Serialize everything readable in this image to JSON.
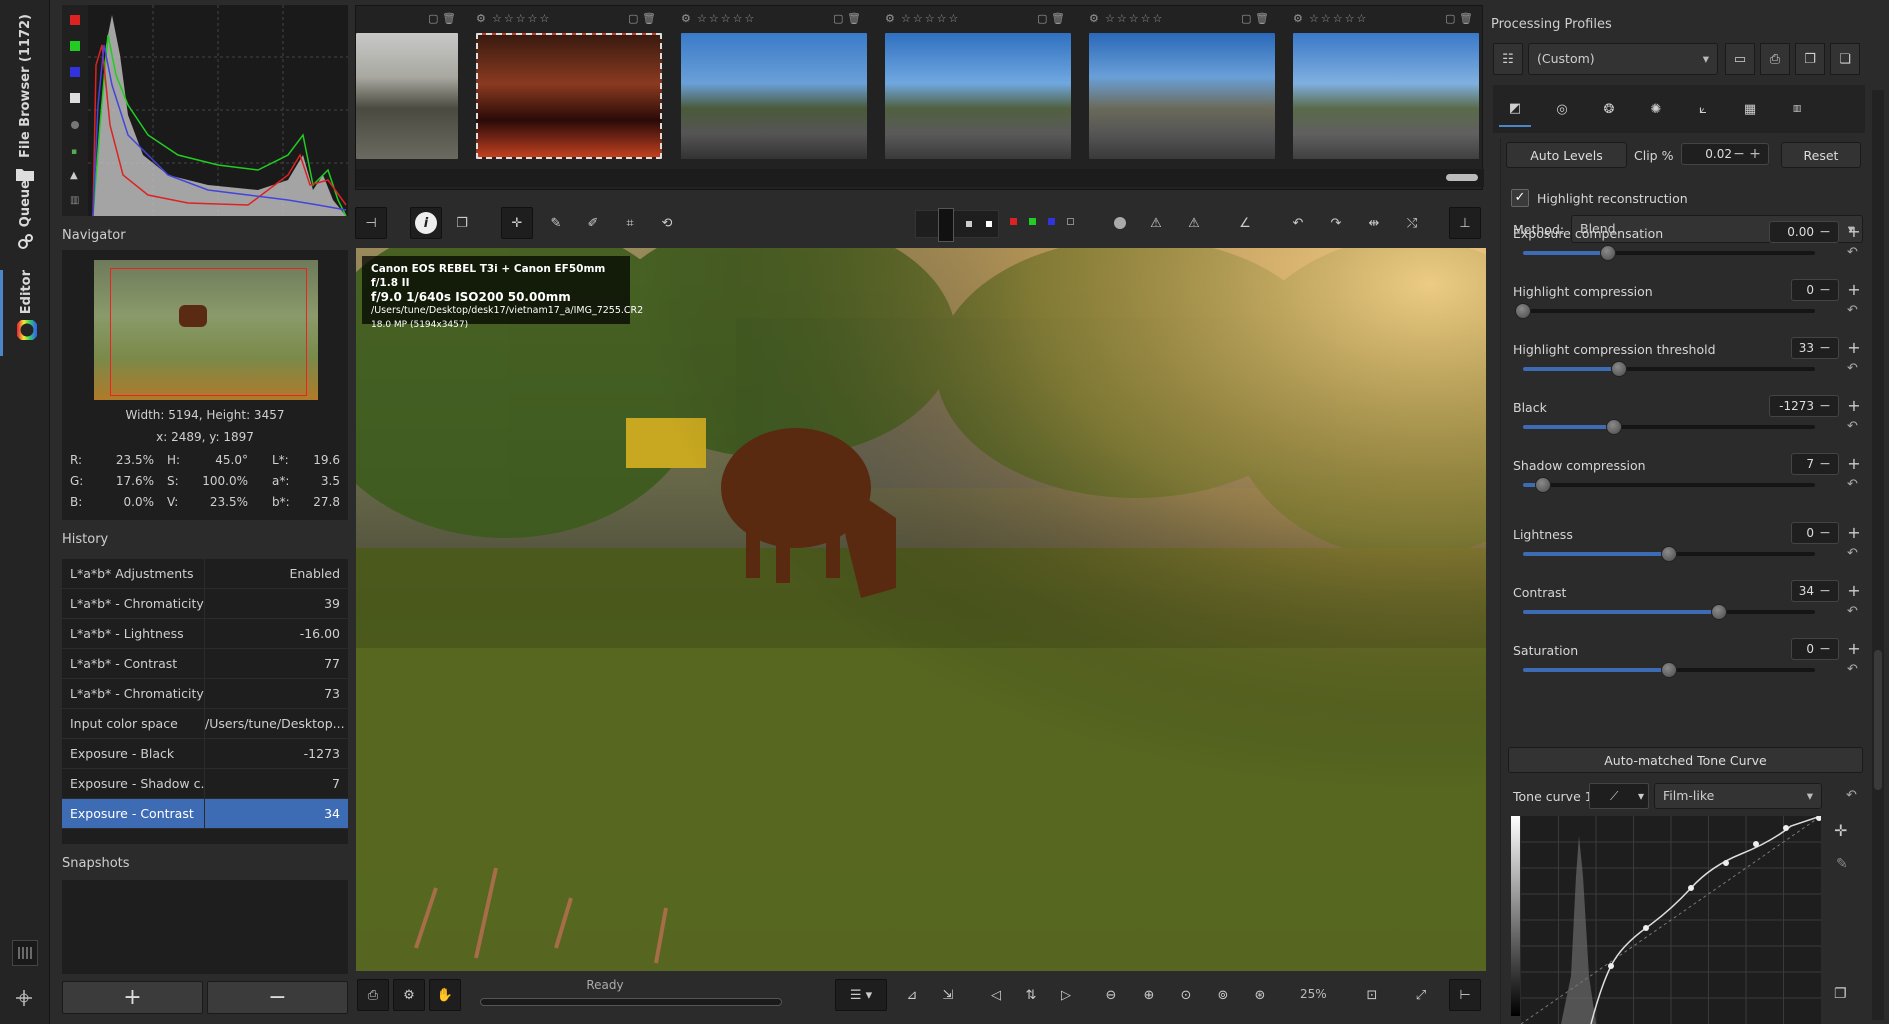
{
  "sidebar": {
    "file_browser_label": "File Browser (1172)",
    "queue_label": "Queue",
    "editor_label": "Editor"
  },
  "navigator": {
    "title": "Navigator",
    "dimensions": "Width: 5194, Height: 3457",
    "coords": "x: 2489, y: 1897",
    "values": {
      "r_label": "R:",
      "r": "23.5%",
      "g_label": "G:",
      "g": "17.6%",
      "b_label": "B:",
      "b": "0.0%",
      "h_label": "H:",
      "h": "45.0°",
      "s_label": "S:",
      "s": "100.0%",
      "v_label": "V:",
      "v": "23.5%",
      "l_label": "L*:",
      "l": "19.6",
      "a_label": "a*:",
      "a": "3.5",
      "bb_label": "b*:",
      "bb": "27.8"
    }
  },
  "history": {
    "title": "History",
    "rows": [
      {
        "name": "L*a*b* Adjustments",
        "value": "Enabled"
      },
      {
        "name": "L*a*b* - Chromaticity",
        "value": "39"
      },
      {
        "name": "L*a*b* - Lightness",
        "value": "-16.00"
      },
      {
        "name": "L*a*b* - Contrast",
        "value": "77"
      },
      {
        "name": "L*a*b* - Chromaticity",
        "value": "73"
      },
      {
        "name": "Input color space",
        "value": "/Users/tune/Desktop..."
      },
      {
        "name": "Exposure - Black",
        "value": "-1273"
      },
      {
        "name": "Exposure - Shadow c...",
        "value": "7"
      },
      {
        "name": "Exposure - Contrast",
        "value": "34"
      }
    ]
  },
  "snapshots": {
    "title": "Snapshots",
    "add_label": "+",
    "remove_label": "−"
  },
  "exif": {
    "camera": "Canon EOS REBEL T3i + Canon EF50mm f/1.8 II",
    "aperture": "f/9.0",
    "shutter": "1/640s",
    "iso": "ISO200",
    "focal": "50.00mm",
    "path": "/Users/tune/Desktop/desk17/vietnam17_a/IMG_7255.CR2",
    "size": "18.0 MP (5194x3457)"
  },
  "status": {
    "text": "Ready",
    "zoom": "25%"
  },
  "profiles": {
    "title": "Processing Profiles",
    "selected": "(Custom)"
  },
  "exposure": {
    "auto_levels": "Auto Levels",
    "clip_label": "Clip %",
    "clip_value": "0.02",
    "reset": "Reset",
    "highlight_reconstruction": "Highlight reconstruction",
    "method_label": "Method:",
    "method_value": "Blend",
    "sliders": [
      {
        "label": "Exposure compensation",
        "value": "0.00",
        "pos": 0.29
      },
      {
        "label": "Highlight compression",
        "value": "0",
        "pos": 0.0
      },
      {
        "label": "Highlight compression threshold",
        "value": "33",
        "pos": 0.33
      },
      {
        "label": "Black",
        "value": "-1273",
        "pos": 0.31
      },
      {
        "label": "Shadow compression",
        "value": "7",
        "pos": 0.07
      },
      {
        "label": "Lightness",
        "value": "0",
        "pos": 0.5
      },
      {
        "label": "Contrast",
        "value": "34",
        "pos": 0.67
      },
      {
        "label": "Saturation",
        "value": "0",
        "pos": 0.5
      }
    ],
    "tone_curve_button": "Auto-matched Tone Curve",
    "tone_curve_label": "Tone curve 1:",
    "tone_curve_mode": "Film-like"
  },
  "colors": {
    "accent": "#3d6cb5",
    "panel_bg": "#2b2b2b",
    "dark_bg": "#1e1e1e"
  }
}
